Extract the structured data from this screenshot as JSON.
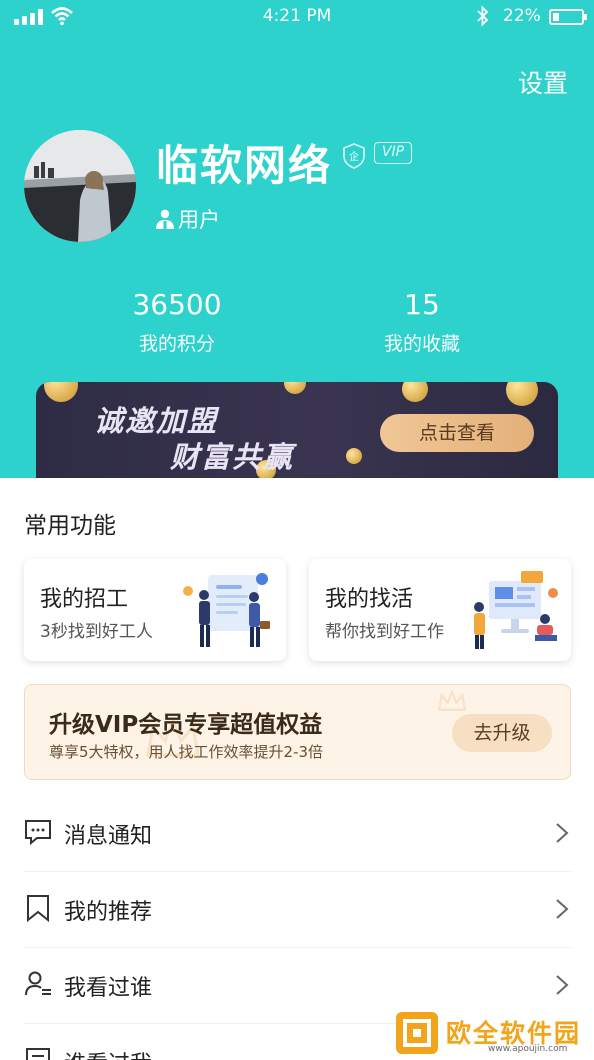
{
  "status_bar": {
    "time": "4:21 PM",
    "battery_text": "22%",
    "battery_level": 0.22,
    "bluetooth_icon": "bluetooth-icon",
    "wifi_icon": "wifi-icon",
    "signal_icon": "signal-icon"
  },
  "header": {
    "settings_label": "设置"
  },
  "profile": {
    "name": "临软网络",
    "enterprise_badge": "企",
    "vip_badge": "VIP",
    "role": "用户",
    "role_icon": "user-icon"
  },
  "stats": [
    {
      "value": "36500",
      "label": "我的积分"
    },
    {
      "value": "15",
      "label": "我的收藏"
    }
  ],
  "banner": {
    "line1": "诚邀加盟",
    "line2": "财富共赢",
    "button": "点击查看"
  },
  "common_functions": {
    "title": "常用功能",
    "cards": [
      {
        "title": "我的招工",
        "subtitle": "3秒找到好工人"
      },
      {
        "title": "我的找活",
        "subtitle": "帮你找到好工作"
      }
    ]
  },
  "vip_promo": {
    "title": "升级VIP会员专享超值权益",
    "subtitle": "尊享5大特权，用人找工作效率提升2-3倍",
    "button": "去升级"
  },
  "menu": [
    {
      "label": "消息通知",
      "icon": "message-icon"
    },
    {
      "label": "我的推荐",
      "icon": "bookmark-icon"
    },
    {
      "label": "我看过谁",
      "icon": "person-list-icon"
    },
    {
      "label": "谁看过我",
      "icon": "document-icon"
    }
  ],
  "watermark": {
    "text": "欧全软件园",
    "url": "www.apoujin.com"
  },
  "colors": {
    "primary": "#2dd2cc",
    "banner_bg": "#2e2c45",
    "banner_button": "#e8b884",
    "vip_bg": "#fdf3e7"
  }
}
